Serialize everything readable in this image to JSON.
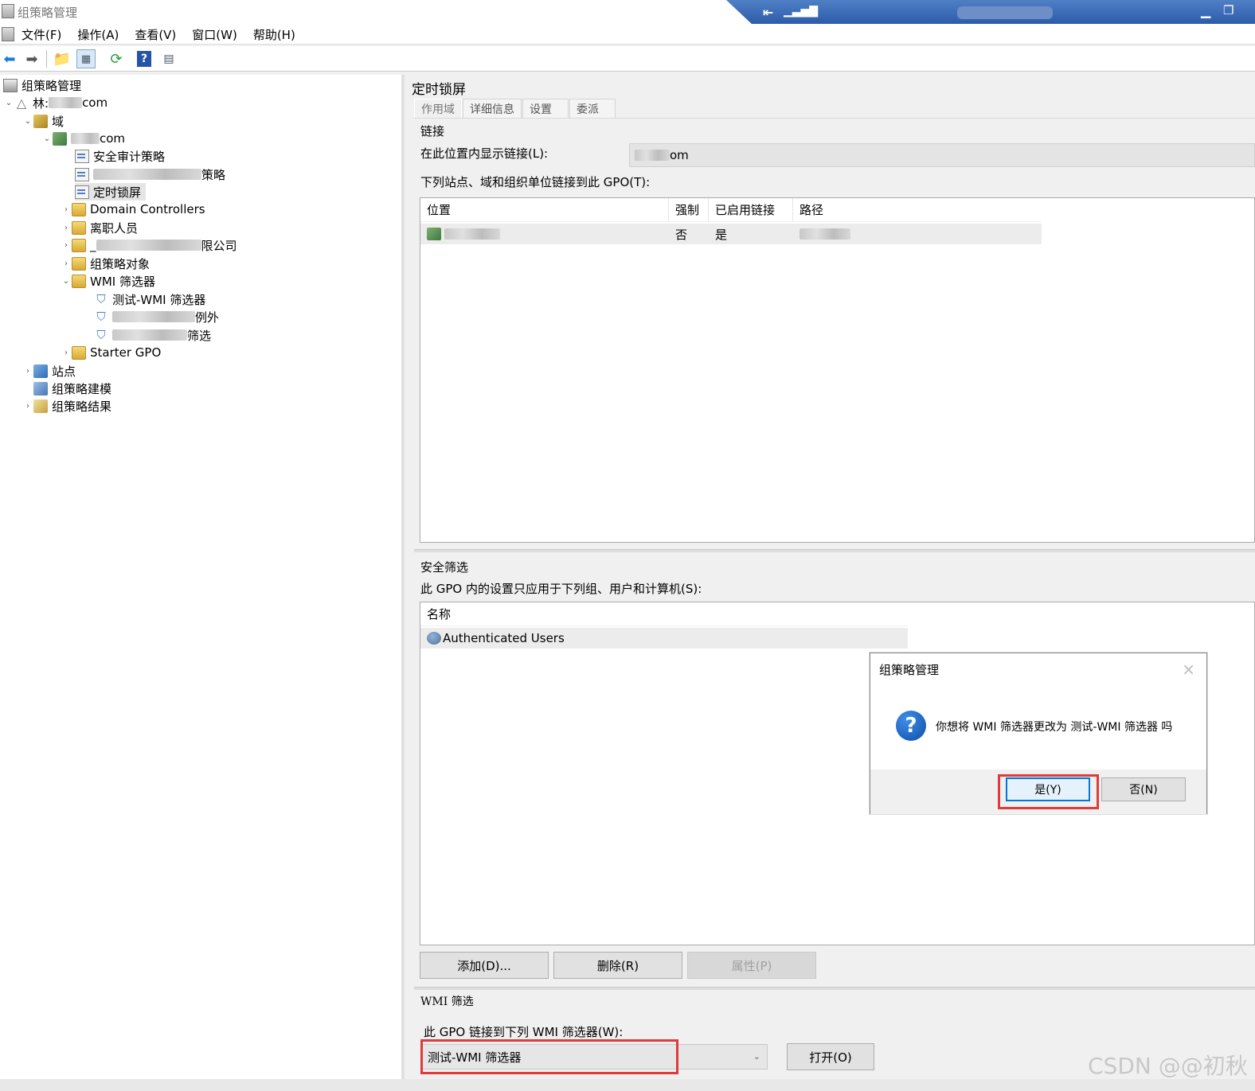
{
  "window": {
    "title": "组策略管理"
  },
  "menu": {
    "items": [
      "文件(F)",
      "操作(A)",
      "查看(V)",
      "窗口(W)",
      "帮助(H)"
    ]
  },
  "tree": {
    "root": "组策略管理",
    "forest_prefix": "林:",
    "forest_suffix": "com",
    "domains": "域",
    "domain_suffix": "com",
    "gpo_audit": "安全审计策略",
    "gpo_blurred_suffix": "策略",
    "gpo_lock": "定时锁屏",
    "domain_controllers": "Domain Controllers",
    "ou_departed": "离职人员",
    "ou_company_prefix": "_",
    "ou_company_suffix": "限公司",
    "gpo_objects": "组策略对象",
    "wmi_filters": "WMI 筛选器",
    "wmi_test": "测试-WMI 筛选器",
    "wmi_blur1_suffix": "例外",
    "wmi_blur2_suffix": "筛选",
    "starter_gpo": "Starter GPO",
    "sites": "站点",
    "modeling": "组策略建模",
    "results": "组策略结果"
  },
  "gpo": {
    "title": "定时锁屏",
    "tabs": [
      "作用域",
      "详细信息",
      "设置",
      "委派"
    ],
    "links_heading": "链接",
    "show_links_label": "在此位置内显示链接(L):",
    "show_links_value_suffix": "om",
    "linked_label": "下列站点、域和组织单位链接到此 GPO(T):",
    "links_columns": [
      "位置",
      "强制",
      "已启用链接",
      "路径"
    ],
    "links_rows": [
      {
        "enforced": "否",
        "enabled": "是"
      }
    ],
    "security_heading": "安全筛选",
    "security_label": "此 GPO 内的设置只应用于下列组、用户和计算机(S):",
    "security_column": "名称",
    "security_rows": [
      "Authenticated Users"
    ],
    "add_button": "添加(D)...",
    "remove_button": "删除(R)",
    "properties_button": "属性(P)",
    "wmi_heading": "WMI 筛选",
    "wmi_label": "此 GPO 链接到下列 WMI 筛选器(W):",
    "wmi_selected": "测试-WMI 筛选器",
    "open_button": "打开(O)"
  },
  "dialog": {
    "title": "组策略管理",
    "message": "你想将 WMI 筛选器更改为 测试-WMI 筛选器 吗",
    "yes_button": "是(Y)",
    "no_button": "否(N)"
  },
  "watermark": "CSDN @@初秋",
  "colors": {
    "highlight": "#e23a3a",
    "rdp_bar": "#3a68b4"
  }
}
